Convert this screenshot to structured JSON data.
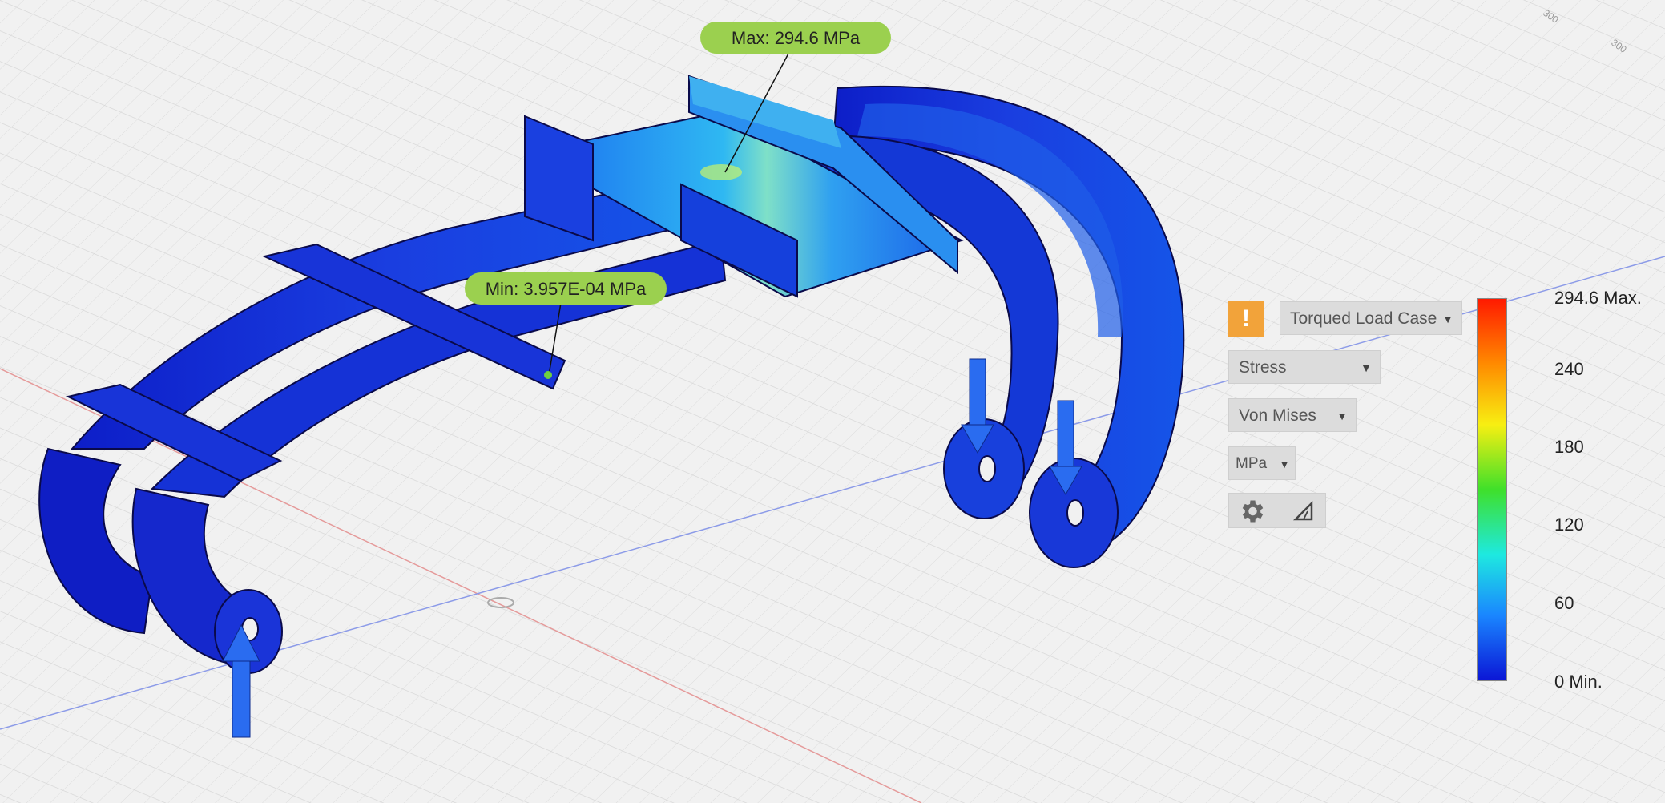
{
  "probes": {
    "max_label": "Max: 294.6 MPa",
    "min_label": "Min: 3.957E-04 MPa"
  },
  "grid_scale_labels": [
    "300",
    "300"
  ],
  "results_panel": {
    "load_case": "Torqued Load Case",
    "warning_icon": "exclamation-warning-icon",
    "result_type": "Stress",
    "component": "Von Mises",
    "units": "MPa",
    "settings_icon": "gear-icon",
    "deformation_icon": "triangle-deformation-icon"
  },
  "legend": {
    "ticks": [
      "294.6 Max.",
      "240",
      "180",
      "120",
      "60",
      "0 Min."
    ],
    "scale": {
      "min": 0,
      "max": 294.6,
      "unit": "MPa"
    },
    "colors": [
      "#ff1a00",
      "#ff8a00",
      "#f7ef12",
      "#3fe02a",
      "#1ee9e0",
      "#1a86ff",
      "#0b16d6"
    ]
  },
  "colors": {
    "accent": "#f2a33a",
    "probe_bubble": "#9bd04f",
    "part_blue": "#1a2fd0"
  }
}
